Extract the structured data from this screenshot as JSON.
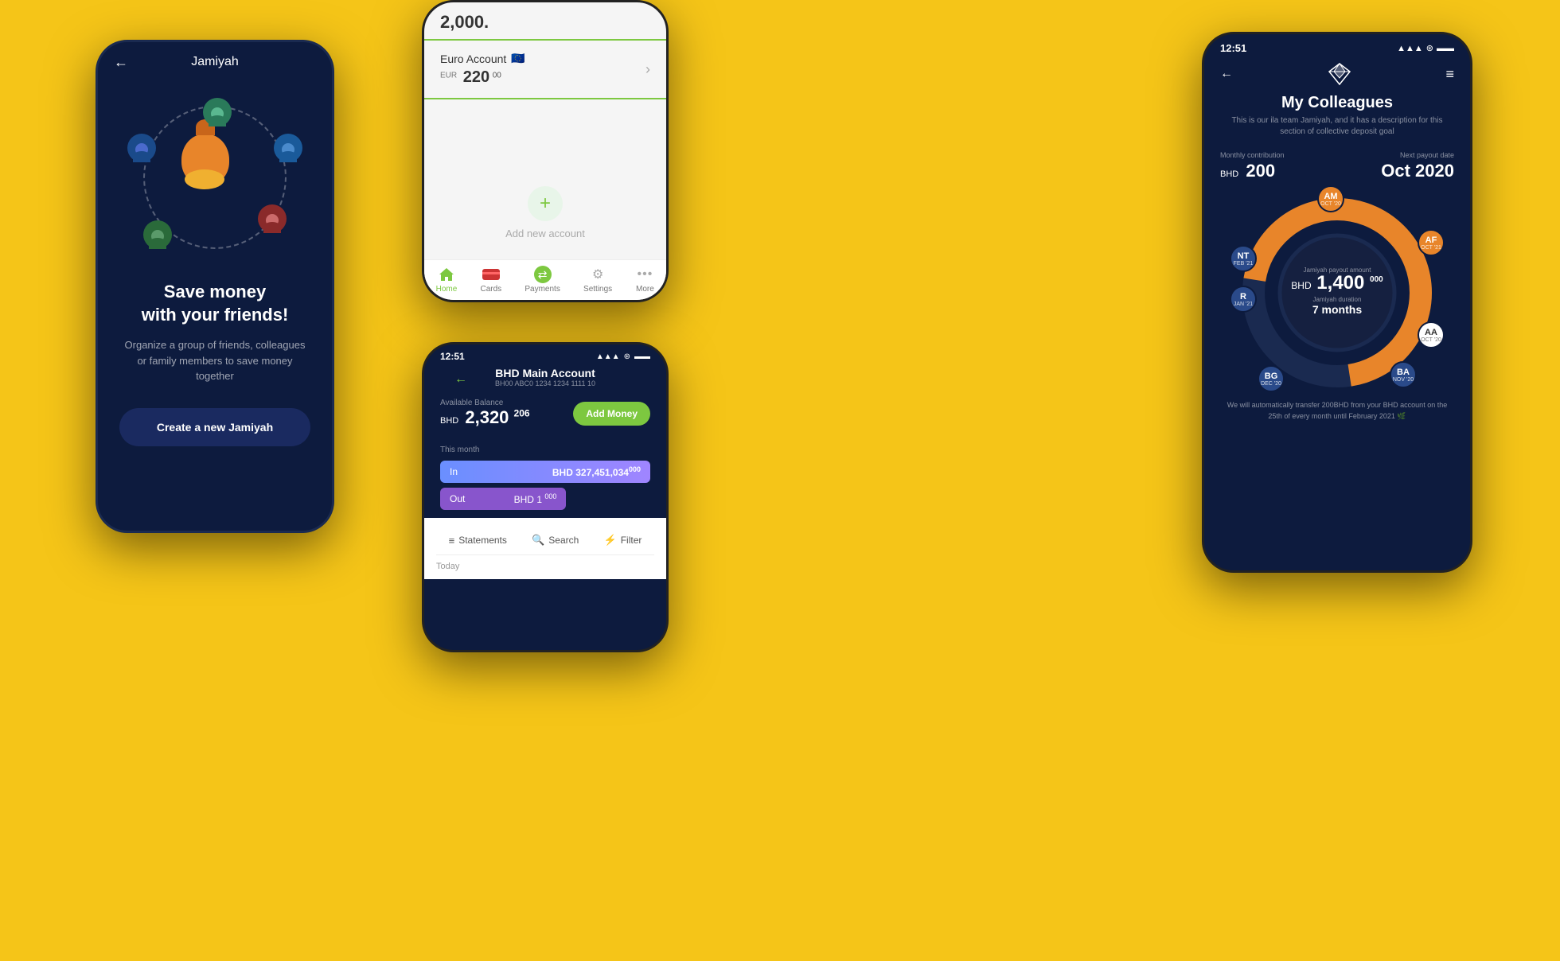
{
  "background_color": "#F5C518",
  "phone1": {
    "header_title": "Jamiyah",
    "back_arrow": "←",
    "main_text": "Save money\nwith your friends!",
    "sub_text": "Organize a group of friends, colleagues or family members to save money together",
    "cta_label": "Create a new Jamiyah",
    "people": [
      {
        "color": "#2a7a5a",
        "initials": ""
      },
      {
        "color": "#1a5a9a",
        "initials": ""
      },
      {
        "color": "#8a2a2a",
        "initials": ""
      },
      {
        "color": "#2a6a3a",
        "initials": ""
      },
      {
        "color": "#1a4a8a",
        "initials": ""
      }
    ]
  },
  "phone2": {
    "top_balance": "2,000.",
    "accounts": [
      {
        "name": "Euro Account",
        "flag": "🇪🇺",
        "currency": "EUR",
        "balance": "220",
        "decimals": "00"
      }
    ],
    "add_account_label": "Add new account",
    "nav_items": [
      {
        "label": "Home",
        "active": true,
        "icon": "home"
      },
      {
        "label": "Cards",
        "active": false,
        "icon": "card"
      },
      {
        "label": "Payments",
        "active": false,
        "icon": "payments"
      },
      {
        "label": "Settings",
        "active": false,
        "icon": "settings"
      },
      {
        "label": "More",
        "active": false,
        "icon": "more"
      }
    ]
  },
  "phone3": {
    "time": "12:51",
    "title": "BHD Main Account",
    "account_number": "BH00 ABC0 1234 1234 1111 10",
    "balance_label": "Available Balance",
    "balance_bhd": "BHD",
    "balance_amount": "2,320",
    "balance_decimals": "206",
    "add_money_label": "Add Money",
    "this_month_label": "This month",
    "in_label": "In",
    "in_amount": "BHD 327,451,034",
    "in_decimals": "000",
    "out_label": "Out",
    "out_bhd": "BHD",
    "out_amount": "1",
    "out_decimals": "000",
    "statements_label": "Statements",
    "search_label": "Search",
    "filter_label": "Filter",
    "today_label": "Today"
  },
  "phone4": {
    "time": "12:51",
    "signal": "▲▲▲",
    "wifi": "WiFi",
    "battery": "Battery",
    "back": "←",
    "menu": "≡",
    "title": "My Colleagues",
    "subtitle": "This is our ila team Jamiyah, and it has a description for this section of collective deposit goal",
    "monthly_contribution_label": "Monthly contribution",
    "monthly_contribution_amount": "200",
    "monthly_contribution_bhd": "BHD",
    "next_payout_label": "Next payout date",
    "next_payout_value": "Oct 2020",
    "payout_amount_label": "Jamiyah payout amount",
    "payout_amount": "1,400",
    "payout_amount_bhd": "BHD",
    "payout_amount_sup": "000",
    "duration_label": "Jamiyah duration",
    "duration_value": "7 months",
    "members": [
      {
        "initials": "AM",
        "date": "OCT '20",
        "color": "#e8852a",
        "position": "top"
      },
      {
        "initials": "AF",
        "date": "OCT '21",
        "color": "#e8852a",
        "position": "top-right"
      },
      {
        "initials": "NT",
        "date": "FEB '21",
        "color": "#2a4a8a",
        "position": "left"
      },
      {
        "initials": "R",
        "date": "JAN '21",
        "color": "#2a4a8a",
        "position": "bottom-left"
      },
      {
        "initials": "AA",
        "date": "OCT '20",
        "color": "#ffffff",
        "position": "right"
      },
      {
        "initials": "BG",
        "date": "DEC '20",
        "color": "#2a4a8a",
        "position": "bottom"
      },
      {
        "initials": "BA",
        "date": "NOV '20",
        "color": "#2a4a8a",
        "position": "bottom-right"
      }
    ],
    "footer_text": "We will automatically transfer 200BHD from your BHD account on the 25th of every month until February 2021 🌿"
  }
}
